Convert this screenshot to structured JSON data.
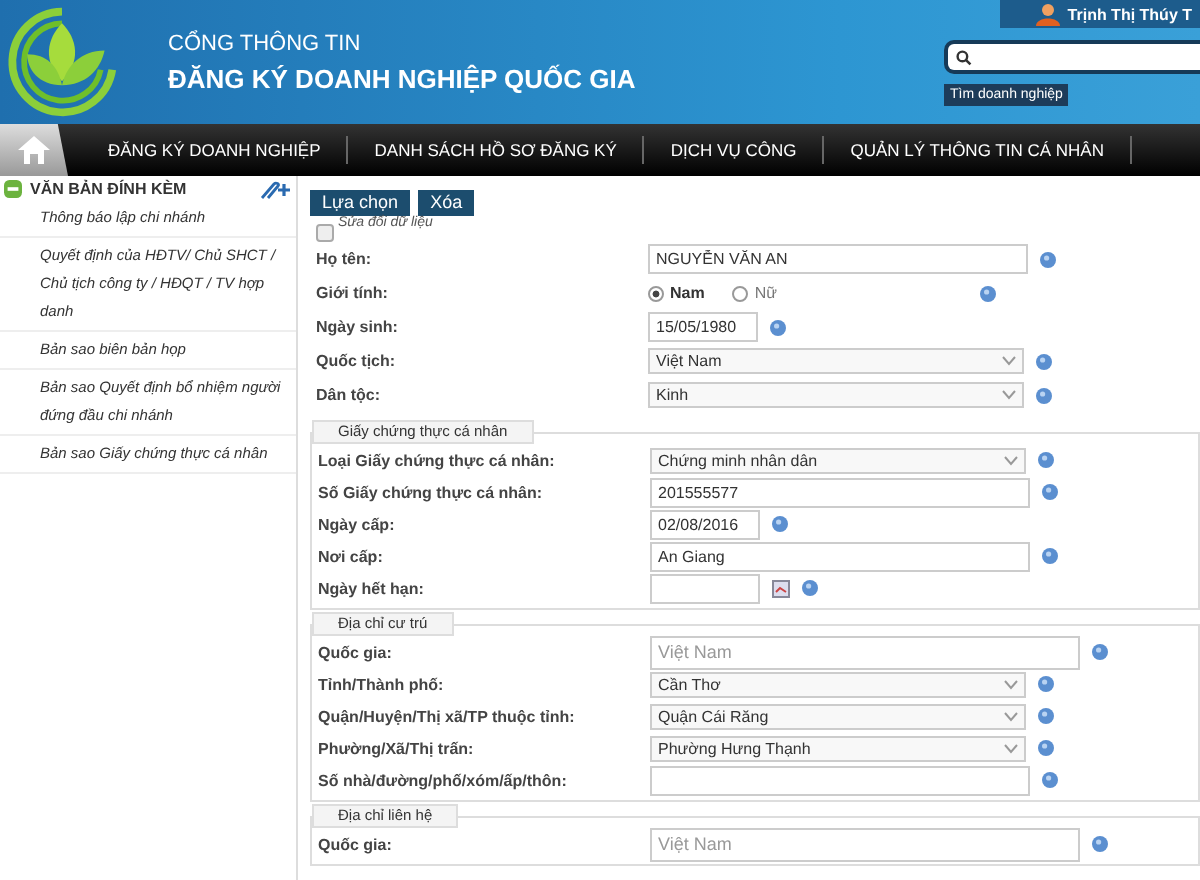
{
  "header": {
    "subtitle": "CỔNG THÔNG TIN",
    "title": "ĐĂNG KÝ DOANH NGHIỆP QUỐC GIA",
    "user": "Trịnh Thị Thúy T",
    "search_hint": "Tìm doanh nghiệp"
  },
  "nav": [
    "ĐĂNG KÝ DOANH NGHIỆP",
    "DANH SÁCH HỒ SƠ ĐĂNG KÝ",
    "DỊCH VỤ CÔNG",
    "QUẢN LÝ THÔNG TIN CÁ NHÂN"
  ],
  "sidebar": {
    "title": "VĂN BẢN ĐÍNH KÈM",
    "items": [
      {
        "label": "Thông báo lập chi nhánh"
      },
      {
        "label": "Quyết định của HĐTV/ Chủ SHCT / Chủ tịch công ty / HĐQT / TV hợp danh"
      },
      {
        "label": "Bản sao biên bản họp"
      },
      {
        "label": "Bản sao Quyết định bổ nhiệm người đứng đầu chi nhánh"
      },
      {
        "label": "Bản sao Giấy chứng thực cá nhân"
      }
    ]
  },
  "buttons": [
    "Lựa chọn",
    "Xóa"
  ],
  "edit_checkbox": {
    "label": "Sửa đổi dữ liệu",
    "checked": false
  },
  "sections": [
    {
      "rows": [
        {
          "label": "Họ tên:",
          "kind": "text",
          "value": "NGUYỄN VĂN AN"
        },
        {
          "label": "Giới tính:",
          "kind": "radio",
          "options": [
            {
              "label": "Nam",
              "selected": true
            },
            {
              "label": "Nữ",
              "selected": false
            }
          ]
        },
        {
          "label": "Ngày sinh:",
          "kind": "date",
          "value": "15/05/1980"
        },
        {
          "label": "Quốc tịch:",
          "kind": "select",
          "value": "Việt Nam"
        },
        {
          "label": "Dân tộc:",
          "kind": "select",
          "value": "Kinh"
        }
      ]
    },
    {
      "legend": "Giấy chứng thực cá nhân",
      "rows": [
        {
          "label": "Loại Giấy chứng thực cá nhân:",
          "kind": "select",
          "value": "Chứng minh nhân dân"
        },
        {
          "label": "Số Giấy chứng thực cá nhân:",
          "kind": "text",
          "value": "201555577"
        },
        {
          "label": "Ngày cấp:",
          "kind": "date",
          "value": "02/08/2016"
        },
        {
          "label": "Nơi cấp:",
          "kind": "text",
          "value": "An Giang"
        },
        {
          "label": "Ngày hết hạn:",
          "kind": "datepicker"
        }
      ]
    },
    {
      "legend": "Địa chỉ cư trú",
      "rows": [
        {
          "label": "Quốc gia:",
          "kind": "long-text",
          "placeholder": "Việt Nam"
        },
        {
          "label": "Tỉnh/Thành phố:",
          "kind": "select",
          "value": "Cần Thơ"
        },
        {
          "label": "Quận/Huyện/Thị xã/TP thuộc tỉnh:",
          "kind": "select",
          "value": "Quận Cái Răng"
        },
        {
          "label": "Phường/Xã/Thị trấn:",
          "kind": "select",
          "value": "Phường Hưng Thạnh"
        },
        {
          "label": "Số nhà/đường/phố/xóm/ấp/thôn:",
          "kind": "text"
        }
      ]
    },
    {
      "legend": "Địa chỉ liên hệ",
      "rows": [
        {
          "label": "Quốc gia:",
          "kind": "long-text",
          "placeholder": "Việt Nam"
        }
      ]
    }
  ]
}
